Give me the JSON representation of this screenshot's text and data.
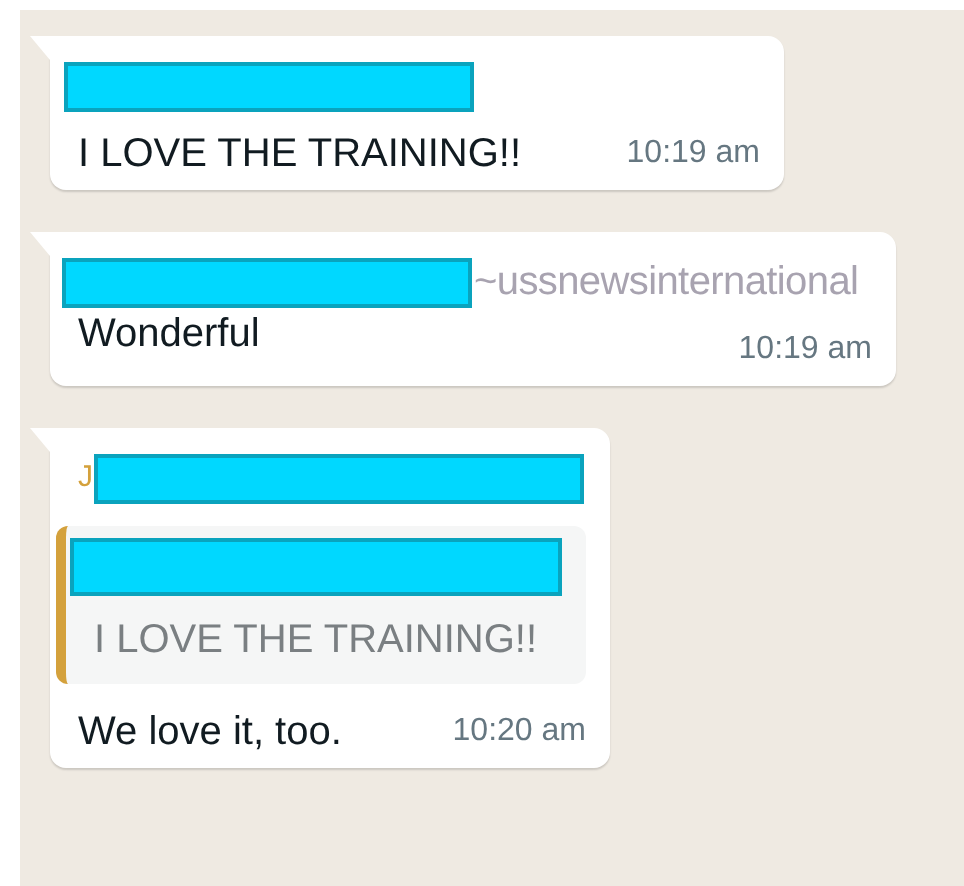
{
  "messages": [
    {
      "sender": {
        "name_redacted": true
      },
      "text": "I LOVE THE TRAINING!!",
      "time": "10:19 am"
    },
    {
      "sender": {
        "name_redacted": true,
        "push_name": "~ussnewsinternational"
      },
      "text": "Wonderful",
      "time": "10:19 am"
    },
    {
      "sender": {
        "initial": "J",
        "name_redacted": true
      },
      "quote": {
        "author_redacted": true,
        "text": "I LOVE THE TRAINING!!"
      },
      "text": "We love it, too.",
      "time": "10:20 am"
    }
  ]
}
